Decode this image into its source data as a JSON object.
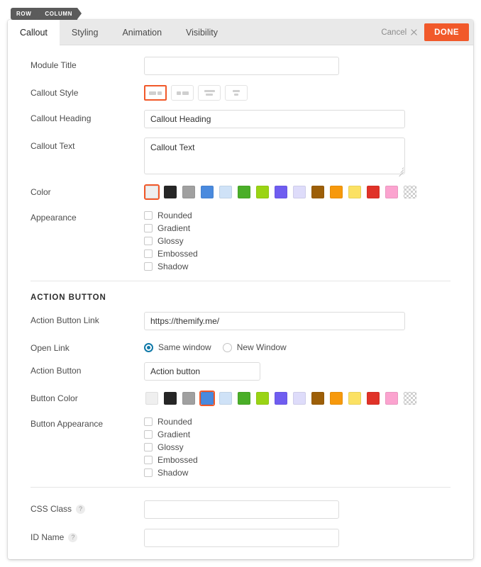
{
  "breadcrumb": {
    "items": [
      "ROW",
      "COLUMN"
    ]
  },
  "tabs": [
    {
      "label": "Callout",
      "active": true
    },
    {
      "label": "Styling",
      "active": false
    },
    {
      "label": "Animation",
      "active": false
    },
    {
      "label": "Visibility",
      "active": false
    }
  ],
  "header": {
    "cancel_label": "Cancel",
    "done_label": "DONE",
    "cancel_icon": "close-icon",
    "accent_color": "#f1592a"
  },
  "fields": {
    "module_title": {
      "label": "Module Title",
      "value": "",
      "placeholder": ""
    },
    "callout_style": {
      "label": "Callout Style",
      "selected_index": 0,
      "options": [
        "style-1",
        "style-2",
        "style-3",
        "style-4"
      ]
    },
    "callout_heading": {
      "label": "Callout Heading",
      "value": "Callout Heading"
    },
    "callout_text": {
      "label": "Callout Text",
      "value": "Callout Text"
    },
    "color": {
      "label": "Color",
      "selected_index": 0,
      "swatches": [
        {
          "name": "white",
          "hex": "#efefef"
        },
        {
          "name": "black",
          "hex": "#262626"
        },
        {
          "name": "gray",
          "hex": "#a0a0a0"
        },
        {
          "name": "blue",
          "hex": "#4a8ade"
        },
        {
          "name": "light-blue",
          "hex": "#cfe2f7"
        },
        {
          "name": "green",
          "hex": "#4aae28"
        },
        {
          "name": "lime",
          "hex": "#9ad414"
        },
        {
          "name": "purple",
          "hex": "#6f5df0"
        },
        {
          "name": "lavender",
          "hex": "#dedcfa"
        },
        {
          "name": "brown",
          "hex": "#9d5f08"
        },
        {
          "name": "orange",
          "hex": "#f7990c"
        },
        {
          "name": "yellow",
          "hex": "#fbe163"
        },
        {
          "name": "red",
          "hex": "#e03228"
        },
        {
          "name": "pink",
          "hex": "#fba3cf"
        },
        {
          "name": "transparent",
          "hex": "transparent"
        }
      ]
    },
    "appearance": {
      "label": "Appearance",
      "options": [
        {
          "label": "Rounded",
          "checked": false
        },
        {
          "label": "Gradient",
          "checked": false
        },
        {
          "label": "Glossy",
          "checked": false
        },
        {
          "label": "Embossed",
          "checked": false
        },
        {
          "label": "Shadow",
          "checked": false
        }
      ]
    },
    "action_section_title": "ACTION BUTTON",
    "action_button_link": {
      "label": "Action Button Link",
      "value": "https://themify.me/"
    },
    "open_link": {
      "label": "Open Link",
      "options": [
        {
          "label": "Same window",
          "selected": true
        },
        {
          "label": "New Window",
          "selected": false
        }
      ]
    },
    "action_button": {
      "label": "Action Button",
      "value": "Action button"
    },
    "button_color": {
      "label": "Button Color",
      "selected_index": 3,
      "swatches": [
        {
          "name": "white",
          "hex": "#efefef"
        },
        {
          "name": "black",
          "hex": "#262626"
        },
        {
          "name": "gray",
          "hex": "#a0a0a0"
        },
        {
          "name": "blue",
          "hex": "#4a8ade"
        },
        {
          "name": "light-blue",
          "hex": "#cfe2f7"
        },
        {
          "name": "green",
          "hex": "#4aae28"
        },
        {
          "name": "lime",
          "hex": "#9ad414"
        },
        {
          "name": "purple",
          "hex": "#6f5df0"
        },
        {
          "name": "lavender",
          "hex": "#dedcfa"
        },
        {
          "name": "brown",
          "hex": "#9d5f08"
        },
        {
          "name": "orange",
          "hex": "#f7990c"
        },
        {
          "name": "yellow",
          "hex": "#fbe163"
        },
        {
          "name": "red",
          "hex": "#e03228"
        },
        {
          "name": "pink",
          "hex": "#fba3cf"
        },
        {
          "name": "transparent",
          "hex": "transparent"
        }
      ]
    },
    "button_appearance": {
      "label": "Button Appearance",
      "options": [
        {
          "label": "Rounded",
          "checked": false
        },
        {
          "label": "Gradient",
          "checked": false
        },
        {
          "label": "Glossy",
          "checked": false
        },
        {
          "label": "Embossed",
          "checked": false
        },
        {
          "label": "Shadow",
          "checked": false
        }
      ]
    },
    "css_class": {
      "label": "CSS Class",
      "value": "",
      "help": "?"
    },
    "id_name": {
      "label": "ID Name",
      "value": "",
      "help": "?"
    }
  }
}
